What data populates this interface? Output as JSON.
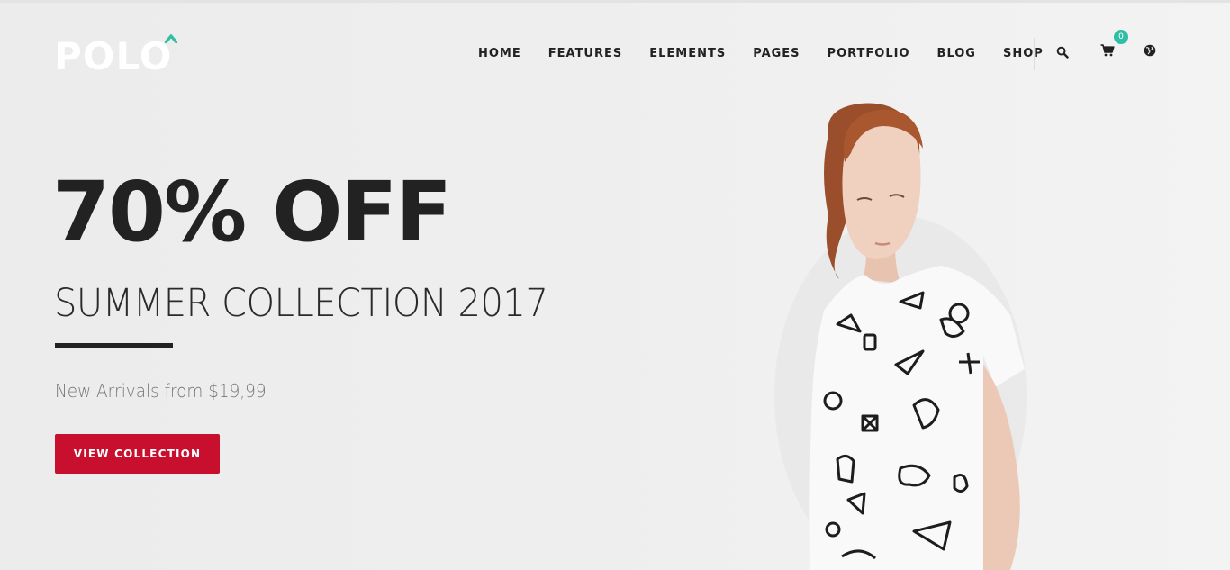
{
  "brand": {
    "name": "POLO",
    "accent": "#2ebfa5"
  },
  "nav": {
    "items": [
      {
        "label": "HOME"
      },
      {
        "label": "FEATURES"
      },
      {
        "label": "ELEMENTS"
      },
      {
        "label": "PAGES"
      },
      {
        "label": "PORTFOLIO"
      },
      {
        "label": "BLOG"
      },
      {
        "label": "SHOP"
      }
    ],
    "icons": [
      "search-icon",
      "cart-icon",
      "globe-icon"
    ],
    "cart_count": "0"
  },
  "hero": {
    "headline": "70% OFF",
    "subhead": "SUMMER COLLECTION 2017",
    "tagline": "New Arrivals from $19,99",
    "cta_label": "VIEW COLLECTION",
    "cta_color": "#c8102e"
  }
}
